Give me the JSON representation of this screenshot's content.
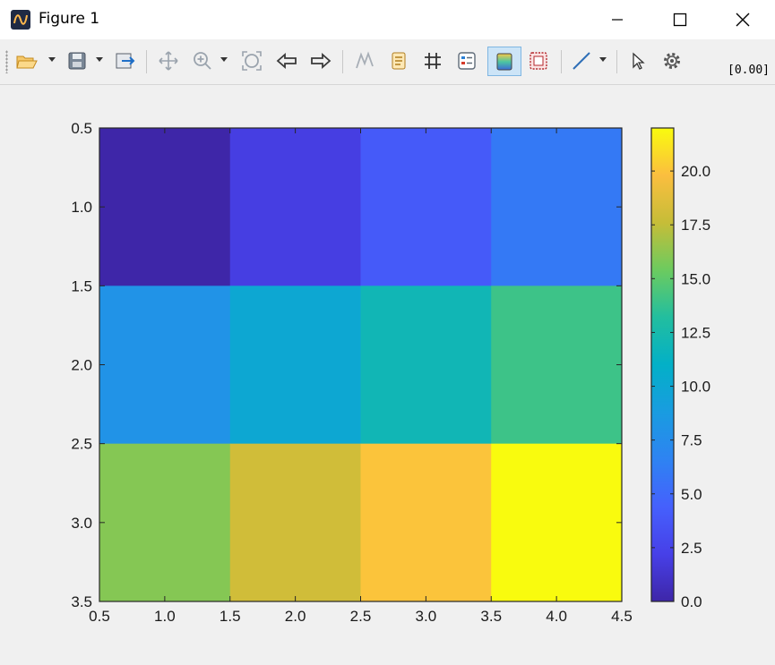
{
  "window": {
    "title": "Figure 1",
    "controls": [
      "minimize",
      "maximize",
      "close"
    ]
  },
  "toolbar": {
    "buttons": [
      "open-folder-icon",
      "save-icon",
      "export-icon",
      "pan-icon",
      "zoom-in-icon",
      "zoom-fit-icon",
      "back-icon",
      "forward-icon",
      "data-cursor-icon",
      "legend-icon",
      "grid-icon",
      "layers-icon",
      "colorbar-icon",
      "frame-icon",
      "line-style-icon",
      "pointer-icon",
      "settings-icon"
    ],
    "active_button": "colorbar-icon",
    "coordinate_readout": "[0.00]"
  },
  "colors": {
    "titlebar": "#ffffff",
    "toolbar": "#f0f0f0",
    "figure_background": "#f0f0f0",
    "active_button": "#cce4f7"
  },
  "chart_data": {
    "type": "heatmap",
    "title": "",
    "xlabel": "",
    "ylabel": "",
    "colormap": "parula",
    "x_centers": [
      1,
      2,
      3,
      4
    ],
    "y_centers": [
      1,
      2,
      3
    ],
    "values": [
      [
        0,
        2,
        4,
        6
      ],
      [
        8,
        10,
        12,
        14
      ],
      [
        16,
        18,
        20,
        22
      ]
    ],
    "xlim": [
      0.5,
      4.5
    ],
    "ylim": [
      3.5,
      0.5
    ],
    "y_reversed": true,
    "xticks": [
      "0.5",
      "1.0",
      "1.5",
      "2.0",
      "2.5",
      "3.0",
      "3.5",
      "4.0",
      "4.5"
    ],
    "yticks": [
      "0.5",
      "1.0",
      "1.5",
      "2.0",
      "2.5",
      "3.0",
      "3.5"
    ],
    "colorbar": {
      "range": [
        0,
        22
      ],
      "ticks": [
        "0.0",
        "2.5",
        "5.0",
        "7.5",
        "10.0",
        "12.5",
        "15.0",
        "17.5",
        "20.0"
      ]
    },
    "grid": false
  }
}
